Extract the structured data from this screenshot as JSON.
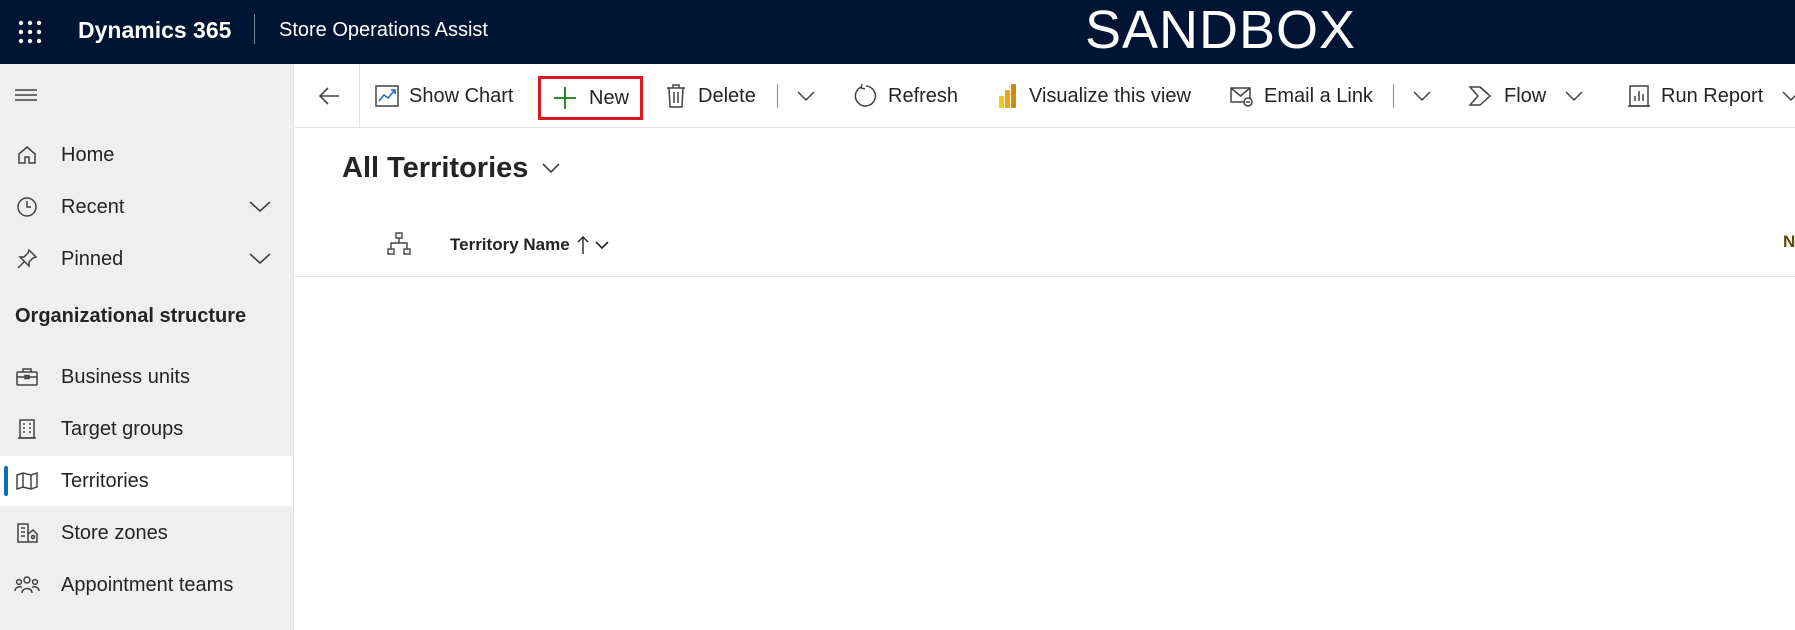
{
  "topbar": {
    "brand": "Dynamics 365",
    "app_name": "Store Operations Assist",
    "environment_banner": "SANDBOX",
    "waffle_icon": "app-launcher-icon",
    "background": "#001433"
  },
  "sidebar": {
    "menu_icon": "hamburger-icon",
    "top_items": [
      {
        "label": "Home",
        "icon": "home-icon"
      },
      {
        "label": "Recent",
        "icon": "clock-icon",
        "expandable": true
      },
      {
        "label": "Pinned",
        "icon": "pin-icon",
        "expandable": true
      }
    ],
    "group_title": "Organizational structure",
    "group_items": [
      {
        "label": "Business units",
        "icon": "briefcase-icon"
      },
      {
        "label": "Target groups",
        "icon": "building-icon"
      },
      {
        "label": "Territories",
        "icon": "map-icon",
        "selected": true
      },
      {
        "label": "Store zones",
        "icon": "store-zone-icon"
      },
      {
        "label": "Appointment teams",
        "icon": "people-team-icon"
      }
    ],
    "selected_accent": "#0f6cbd"
  },
  "commandbar": {
    "back_icon": "back-arrow-icon",
    "items": [
      {
        "label": "Show Chart",
        "icon": "chart-icon"
      },
      {
        "label": "New",
        "icon": "plus-icon",
        "highlighted": true
      },
      {
        "label": "Delete",
        "icon": "trash-icon",
        "has_split_dropdown": true
      },
      {
        "label": "Refresh",
        "icon": "refresh-icon"
      },
      {
        "label": "Visualize this view",
        "icon": "power-bi-icon"
      },
      {
        "label": "Email a Link",
        "icon": "email-link-icon",
        "has_split_dropdown": true
      },
      {
        "label": "Flow",
        "icon": "flow-icon",
        "has_dropdown": true
      },
      {
        "label": "Run Report",
        "icon": "report-icon",
        "has_dropdown": true
      }
    ],
    "highlight_color": "#e0151f",
    "plus_color": "#107c10"
  },
  "view": {
    "title": "All Territories",
    "grid": {
      "hierarchy_icon": "hierarchy-icon",
      "columns": [
        {
          "label": "Territory Name",
          "sort": "ascending"
        }
      ],
      "clipped_next_column_initial": "N"
    }
  }
}
